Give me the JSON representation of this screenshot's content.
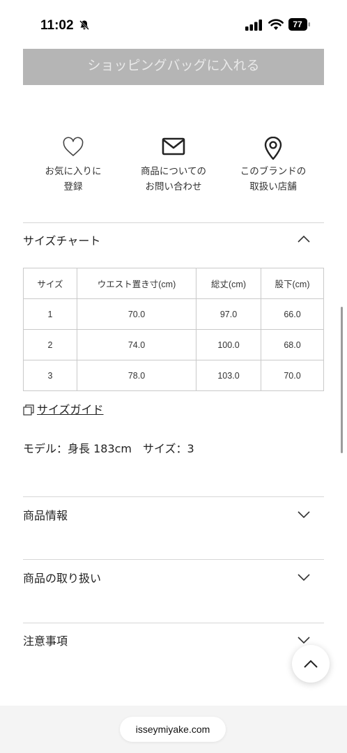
{
  "status_bar": {
    "time": "11:02",
    "battery": "77"
  },
  "cart_button": {
    "label": "ショッピングバッグに入れる"
  },
  "actions": [
    {
      "line1": "お気に入りに",
      "line2": "登録"
    },
    {
      "line1": "商品についての",
      "line2": "お問い合わせ"
    },
    {
      "line1": "このブランドの",
      "line2": "取扱い店舗"
    }
  ],
  "size_chart": {
    "title": "サイズチャート",
    "headers": [
      "サイズ",
      "ウエスト置き寸(cm)",
      "総丈(cm)",
      "股下(cm)"
    ],
    "rows": [
      [
        "1",
        "70.0",
        "97.0",
        "66.0"
      ],
      [
        "2",
        "74.0",
        "100.0",
        "68.0"
      ],
      [
        "3",
        "78.0",
        "103.0",
        "70.0"
      ]
    ]
  },
  "size_guide": {
    "label": "サイズガイド"
  },
  "model_info": "モデル：身長 183cm　サイズ：3",
  "sections": {
    "product_info": "商品情報",
    "handling": "商品の取り扱い",
    "notes": "注意事項"
  },
  "browser": {
    "url": "isseymiyake.com"
  }
}
